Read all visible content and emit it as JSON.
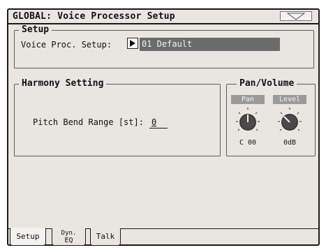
{
  "window": {
    "title": "GLOBAL: Voice Processor Setup"
  },
  "setup": {
    "section_title": "Setup",
    "voice_proc_label": "Voice Proc. Setup:",
    "voice_proc_value": "01 Default"
  },
  "harmony": {
    "section_title": "Harmony Setting",
    "pitch_bend_label": "Pitch Bend Range [st]:",
    "pitch_bend_value": "0"
  },
  "pan_volume": {
    "section_title": "Pan/Volume",
    "pan_label": "Pan",
    "pan_value": "C 00",
    "level_label": "Level",
    "level_value": "0dB"
  },
  "tabs": [
    {
      "label": "Setup",
      "active": true
    },
    {
      "label_line1": "Dyn.",
      "label_line2": "EQ",
      "active": false
    },
    {
      "label": "Talk",
      "active": false
    }
  ],
  "icons": [
    "menu-triangle-icon",
    "play-arrow-icon",
    "pan-knob-icon",
    "level-knob-icon"
  ]
}
